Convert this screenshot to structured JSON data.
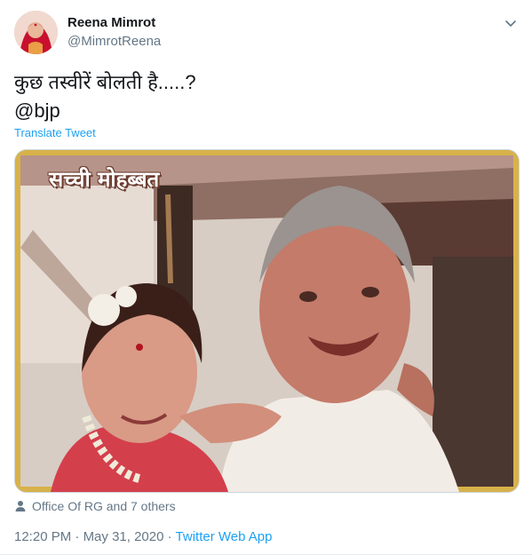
{
  "author": {
    "display_name": "Reena Mimrot",
    "handle": "@MimrotReena"
  },
  "tweet": {
    "text_line1": "कुछ तस्वीरें बोलती है.....?",
    "text_line2": "@bjp",
    "translate_label": "Translate Tweet"
  },
  "media": {
    "overlay_caption": "सच्ची मोहब्बत"
  },
  "tagged": {
    "text": "Office Of RG and 7 others"
  },
  "meta": {
    "time": "12:20 PM",
    "separator1": " · ",
    "date": "May 31, 2020",
    "separator2": " · ",
    "source": "Twitter Web App"
  },
  "colors": {
    "link": "#1da1f2",
    "muted": "#657786",
    "text": "#14171a"
  },
  "icons": {
    "caret": "chevron-down-icon",
    "tagged": "person-icon"
  }
}
